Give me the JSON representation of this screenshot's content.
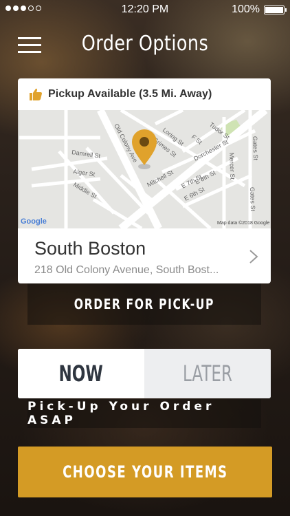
{
  "status_bar": {
    "time": "12:20 PM",
    "battery": "100%",
    "signal_bars_filled": 3,
    "signal_bars_total": 5
  },
  "header": {
    "title": "Order Options",
    "menu_icon": "hamburger-menu-icon"
  },
  "location_card": {
    "availability": "Pickup Available (3.5 Mi. Away)",
    "availability_icon": "thumbs-up-icon",
    "map": {
      "attribution_logo": "Google",
      "attribution": "Map data ©2018 Google",
      "street_labels": [
        "Old Colony Ave",
        "Loring St",
        "Grimes St",
        "F St",
        "Tudor St",
        "Dorchester St",
        "Mercer St",
        "Gates St",
        "Damrell St",
        "Alger St",
        "Middle St",
        "Mitchell St",
        "E 8th St",
        "E 7th St",
        "E 6th St",
        "Gates St"
      ],
      "pin_icon": "location-pin-icon"
    },
    "place_name": "South Boston",
    "place_address": "218 Old Colony Avenue, South Bost...",
    "chevron_icon": "chevron-right-icon"
  },
  "order_type": "ORDER FOR PICK-UP",
  "timing_toggle": {
    "now_label": "NOW",
    "later_label": "LATER",
    "selected": "NOW"
  },
  "timing_note": "Pick-Up Your Order ASAP",
  "primary_button": "CHOOSE YOUR ITEMS",
  "colors": {
    "accent": "#d49b25",
    "pin": "#e0a22c",
    "text_dark": "#2f3640"
  }
}
